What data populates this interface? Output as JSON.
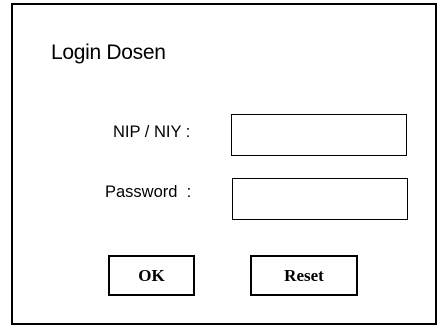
{
  "form": {
    "title": "Login Dosen",
    "nip_label": "NIP / NIY :",
    "nip_value": "",
    "password_label": "Password  :",
    "password_value": "",
    "ok_label": "OK",
    "reset_label": "Reset"
  }
}
